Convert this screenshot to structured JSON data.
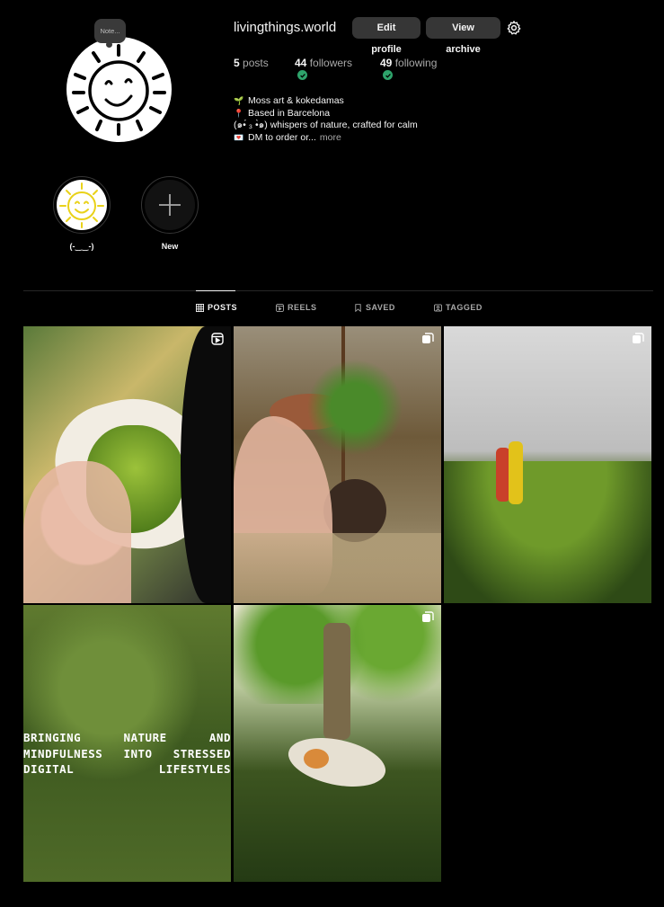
{
  "profile": {
    "username": "livingthings.world",
    "note_label": "Note...",
    "edit_profile": "Edit profile",
    "view_archive": "View archive",
    "settings_icon": "gear-icon"
  },
  "stats": {
    "posts_count": "5",
    "posts_label": "posts",
    "followers_count": "44",
    "followers_label": "followers",
    "following_count": "49",
    "following_label": "following"
  },
  "bio": {
    "line1_icon": "🌱",
    "line1": "Moss art & kokedamas",
    "line2_icon": "📍",
    "line2": "Based in Barcelona",
    "line3": "(๑•́ ₃ •̀๑) whispers of nature, crafted for calm",
    "line4_icon": "💌",
    "line4": "DM to order or...",
    "more": "more"
  },
  "highlights": [
    {
      "label": "(-‿‿-)"
    },
    {
      "label": "New"
    }
  ],
  "tabs": [
    {
      "label": "POSTS",
      "active": true
    },
    {
      "label": "REELS",
      "active": false
    },
    {
      "label": "SAVED",
      "active": false
    },
    {
      "label": "TAGGED",
      "active": false
    }
  ],
  "posts": [
    {
      "type": "reel",
      "badge": "reels-icon"
    },
    {
      "type": "video",
      "badge": "clip-icon"
    },
    {
      "type": "video",
      "badge": "clip-icon"
    },
    {
      "type": "image",
      "overlay_lines": [
        [
          "BRINGING",
          "NATURE",
          "AND"
        ],
        [
          "MINDFULNESS",
          "INTO",
          "STRESSED"
        ],
        [
          "DIGITAL",
          "LIFESTYLES"
        ]
      ]
    },
    {
      "type": "video",
      "badge": "clip-icon"
    }
  ],
  "colors": {
    "background": "#000000",
    "button": "#363636",
    "verified_check": "#2ea36b",
    "muted_text": "#a8a8a8"
  }
}
